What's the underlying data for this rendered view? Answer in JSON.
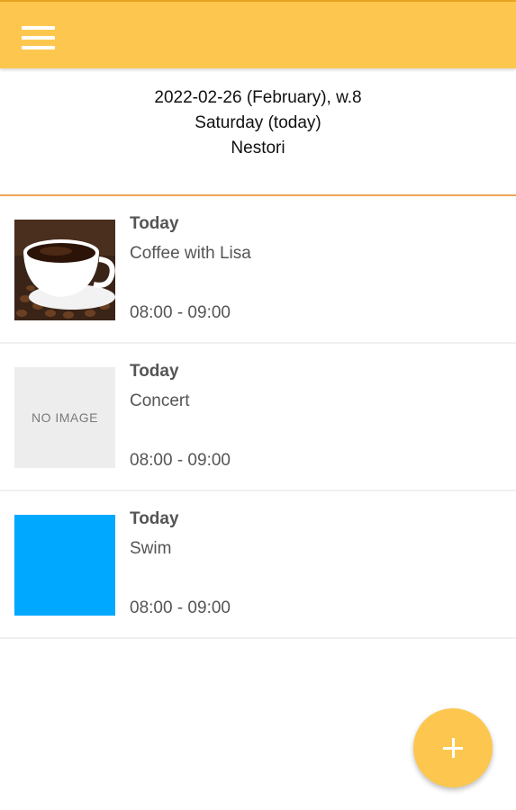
{
  "header": {
    "date_line": "2022-02-26 (February), w.8",
    "day_line": "Saturday (today)",
    "name_line": "Nestori"
  },
  "events": [
    {
      "day": "Today",
      "title": "Coffee with Lisa",
      "time": "08:00 - 09:00",
      "image": "coffee-photo"
    },
    {
      "day": "Today",
      "title": "Concert",
      "time": "08:00 - 09:00",
      "image_text": "NO IMAGE"
    },
    {
      "day": "Today",
      "title": "Swim",
      "time": "08:00 - 09:00",
      "image_color": "#00A8FF"
    }
  ],
  "colors": {
    "accent": "#FDC74F",
    "divider": "#F0A45A"
  },
  "icons": {
    "menu": "menu-icon",
    "add": "plus-icon"
  }
}
